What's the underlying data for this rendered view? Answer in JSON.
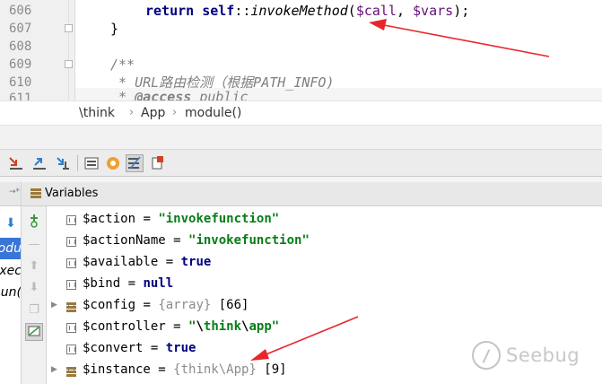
{
  "editor": {
    "line_numbers": [
      "606",
      "607",
      "608",
      "609",
      "610",
      "611"
    ],
    "lines": {
      "l606": {
        "kw_return": "return",
        "kw_self": "self",
        "op": "::",
        "method": "invokeMethod",
        "args_open": "(",
        "arg1": "$call",
        "sep": ", ",
        "arg2": "$vars",
        "args_close": ");"
      },
      "l607": {
        "text": "}"
      },
      "l609": {
        "text": "/**"
      },
      "l610": {
        "text": " * URL路由检测（根据PATH_INFO)"
      },
      "l611": {
        "star": " * ",
        "tag": "@access",
        "rest": " public"
      }
    }
  },
  "breadcrumb": {
    "items": [
      "\\think",
      "App",
      "module()"
    ],
    "separator": "›"
  },
  "toolbar": {
    "icons": [
      "step-over-icon",
      "step-into-icon",
      "force-step-into-icon",
      "step-out-icon",
      "run-to-cursor-icon",
      "evaluate-expression-icon",
      "watch-icon",
      "variables-view-icon",
      "restore-layout-icon"
    ]
  },
  "frames": {
    "header_glyph": "→*",
    "items": [
      "odu",
      "xec",
      "un("
    ]
  },
  "variables": {
    "title": "Variables",
    "rows": [
      {
        "name": "$action",
        "eq": " = ",
        "value": "\"invokefunction\"",
        "kind": "string",
        "expandable": false
      },
      {
        "name": "$actionName",
        "eq": " = ",
        "value": "\"invokefunction\"",
        "kind": "string",
        "expandable": false
      },
      {
        "name": "$available",
        "eq": " = ",
        "value": "true",
        "kind": "keyword",
        "expandable": false
      },
      {
        "name": "$bind",
        "eq": " = ",
        "value": "null",
        "kind": "keyword",
        "expandable": false
      },
      {
        "name": "$config",
        "eq": " = ",
        "type": "{array}",
        "value": " [66]",
        "kind": "typed",
        "expandable": true
      },
      {
        "name": "$controller",
        "eq": " = ",
        "value_parts": [
          "\"",
          "\\",
          "think",
          "\\",
          "app\""
        ],
        "kind": "path",
        "expandable": false
      },
      {
        "name": "$convert",
        "eq": " = ",
        "value": "true",
        "kind": "keyword",
        "expandable": false
      },
      {
        "name": "$instance",
        "eq": " = ",
        "type": "{think\\App}",
        "value": " [9]",
        "kind": "typed",
        "expandable": true
      }
    ]
  },
  "watermark": {
    "text": "Seebug"
  },
  "colors": {
    "arrow": "#e8262a",
    "keyword": "#000080",
    "string": "#067d17",
    "variable": "#660e7a",
    "comment": "#808080",
    "selection": "#3875d7"
  }
}
